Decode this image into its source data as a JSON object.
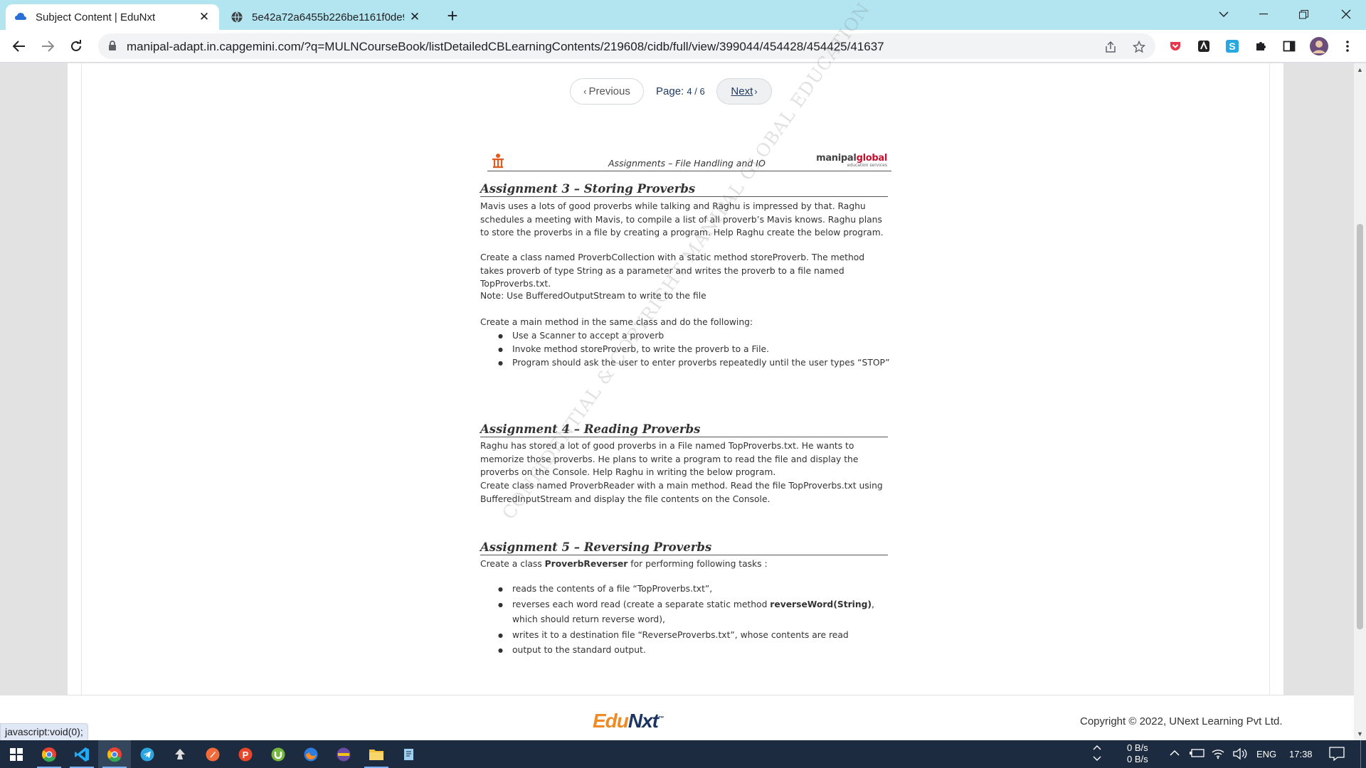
{
  "browser": {
    "tabs": [
      {
        "title": "Subject Content | EduNxt",
        "active": true,
        "favicon": "edunxt-cloud-icon"
      },
      {
        "title": "5e42a72a6455b226be1161f0de9",
        "active": false,
        "favicon": "globe-icon"
      }
    ],
    "url": "manipal-adapt.in.capgemini.com/?q=MULNCourseBook/listDetailedCBLearningContents/219608/cidb/full/view/399044/454428/454425/41637"
  },
  "pagination": {
    "prev_label": "Previous",
    "page_label": "Page:",
    "page_value": "4 / 6",
    "next_label": "Next"
  },
  "document": {
    "header_title": "Assignments – File Handling and IO",
    "logo_brand_a": "manipal",
    "logo_brand_b": "global",
    "logo_sub": "education services",
    "a3": {
      "title": "Assignment 3 – Storing Proverbs",
      "p1": "Mavis uses a lots of good proverbs while talking and Raghu is impressed by that. Raghu schedules a meeting with Mavis, to compile a list of all proverb’s Mavis knows. Raghu plans to store the proverbs in a file by creating a program. Help Raghu create the below program.",
      "p2": "Create a class named ProverbCollection with a static method storeProverb. The method takes proverb of type String as a parameter and writes the proverb to a file named TopProverbs.txt.",
      "p3": "Note: Use BufferedOutputStream to write to the file",
      "p4": "Create a main method in the same class and do the following:",
      "bullets": [
        "Use a Scanner to accept a proverb",
        "Invoke method storeProverb, to write the proverb to a File.",
        "Program should ask the user to enter proverbs repeatedly until the user types “STOP”"
      ]
    },
    "a4": {
      "title": "Assignment 4 – Reading Proverbs",
      "p1": "Raghu has stored a lot of good proverbs in a File named TopProverbs.txt. He wants to memorize those proverbs. He plans to write a program to read the file and display the proverbs on the Console. Help Raghu in writing the below program.",
      "p2": "Create class named ProverbReader with a main method. Read the file TopProverbs.txt using BufferedInputStream and display the file contents on the Console."
    },
    "a5": {
      "title": "Assignment 5 – Reversing Proverbs",
      "intro_pre": "Create a class ",
      "intro_bold": "ProverbReverser",
      "intro_post": " for performing following tasks :",
      "b1": "reads the contents of a file “TopProverbs.txt”,",
      "b2_pre": "reverses each word read (create a separate static method ",
      "b2_bold": "reverseWord(String)",
      "b2_post": ", which should return reverse word),",
      "b3": "writes it to a destination file “ReverseProverbs.txt”, whose contents are read",
      "b4": "output to the standard output."
    },
    "watermark": "CONFIDENTIAL & COPYRIGHT MANIPAL GLOBAL EDUCATION"
  },
  "footer": {
    "brand_a": "Edu",
    "brand_b": "Nxt",
    "tm": "™",
    "copyright": "Copyright © 2022, UNext Learning Pvt Ltd."
  },
  "status_text": "javascript:void(0);",
  "taskbar": {
    "net_up": "0 B/s",
    "net_down": "0 B/s",
    "lang": "ENG",
    "time": "17:38"
  }
}
